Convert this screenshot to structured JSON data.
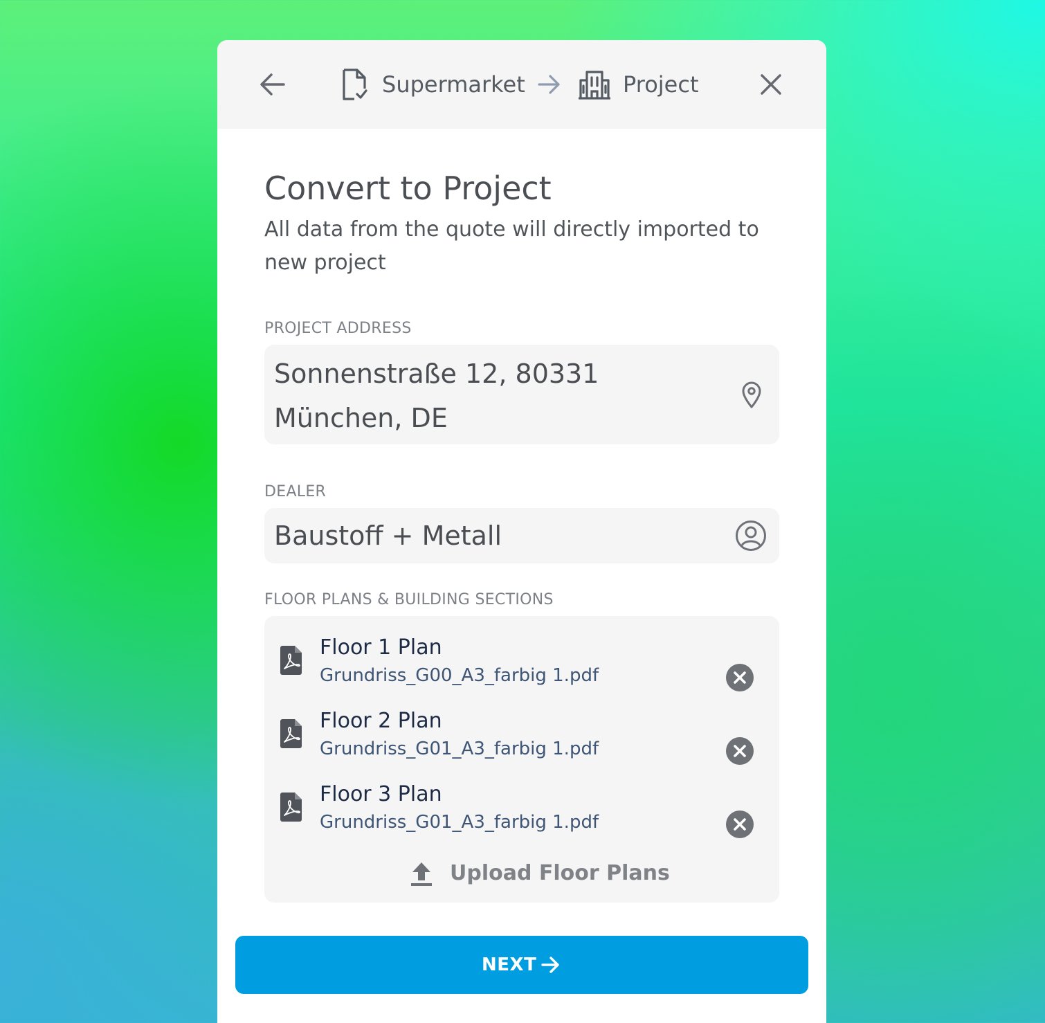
{
  "header": {
    "back_icon": "arrow-left-icon",
    "from_icon": "document-check-icon",
    "from_label": "Supermarket",
    "arrow_icon": "arrow-right-icon",
    "to_icon": "building-icon",
    "to_label": "Project",
    "close_icon": "close-icon"
  },
  "page": {
    "title": "Convert to Project",
    "subtitle": "All data from the quote will directly imported to new project"
  },
  "address": {
    "label": "PROJECT ADDRESS",
    "line1": "Sonnenstraße 12, 80331",
    "line2": "München, DE",
    "icon": "map-pin-icon"
  },
  "dealer": {
    "label": "DEALER",
    "value": "Baustoff + Metall",
    "icon": "user-circle-icon"
  },
  "floor_plans": {
    "label": "FLOOR PLANS & BUILDING SECTIONS",
    "files": [
      {
        "title": "Floor 1 Plan",
        "file": "Grundriss_G00_A3_farbig 1.pdf",
        "icon": "pdf-icon",
        "remove_icon": "remove-circle-icon"
      },
      {
        "title": "Floor 2 Plan",
        "file": "Grundriss_G01_A3_farbig 1.pdf",
        "icon": "pdf-icon",
        "remove_icon": "remove-circle-icon"
      },
      {
        "title": "Floor 3 Plan",
        "file": "Grundriss_G01_A3_farbig 1.pdf",
        "icon": "pdf-icon",
        "remove_icon": "remove-circle-icon"
      }
    ],
    "upload_label": "Upload Floor Plans",
    "upload_icon": "upload-icon"
  },
  "footer": {
    "next_label": "NEXT",
    "next_icon": "arrow-right-icon"
  },
  "colors": {
    "primary": "#009ee0",
    "header_bg": "#f5f5f5",
    "field_bg": "#f5f5f5",
    "text_dark": "#1d2b45"
  }
}
